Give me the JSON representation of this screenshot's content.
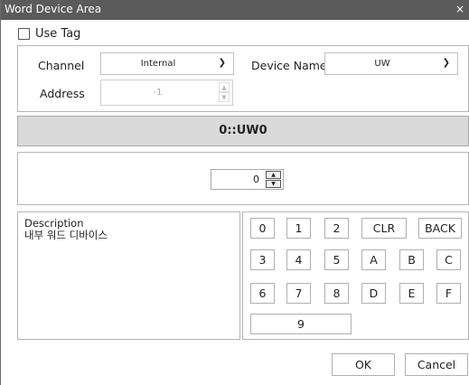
{
  "window": {
    "title": "Word Device Area",
    "close_glyph": "×"
  },
  "use_tag": {
    "label": "Use Tag",
    "checked": false
  },
  "channel": {
    "label": "Channel",
    "value": "Internal"
  },
  "device_name": {
    "label": "Device Name",
    "value": "UW"
  },
  "address": {
    "label": "Address",
    "value": "-1"
  },
  "device_code": "0::UW0",
  "offset": {
    "value": "0"
  },
  "description": {
    "title": "Description",
    "text": "내부 워드 디바이스"
  },
  "keypad": {
    "keys": [
      "0",
      "1",
      "2",
      "CLR",
      "BACK",
      "3",
      "4",
      "5",
      "A",
      "B",
      "C",
      "6",
      "7",
      "8",
      "D",
      "E",
      "F",
      "9"
    ]
  },
  "buttons": {
    "ok": "OK",
    "cancel": "Cancel"
  }
}
